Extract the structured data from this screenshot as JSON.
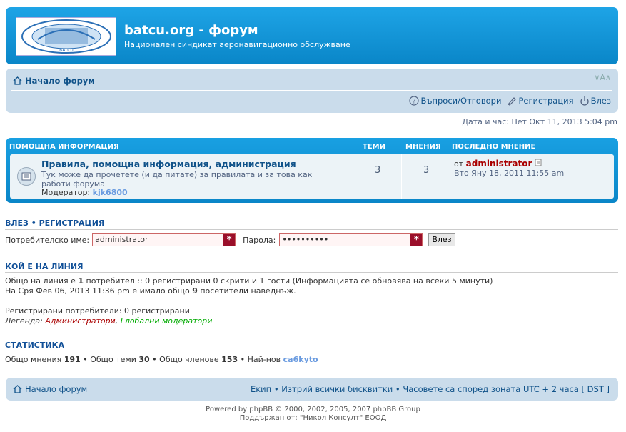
{
  "header": {
    "title": "batcu.org - форум",
    "description": "Национален синдикат аеронавигационно обслужване",
    "logo_text": "BATCU"
  },
  "navbar": {
    "home": "Начало форум",
    "font_controls": "∨A∧",
    "faq": "Въпроси/Отговори",
    "register": "Регистрация",
    "login": "Влез"
  },
  "datetime": "Дата и час: Пет Окт 11, 2013 5:04 pm",
  "forum_table": {
    "headers": {
      "section": "ПОМОЩНА ИНФОРМАЦИЯ",
      "topics": "ТЕМИ",
      "posts": "МНЕНИЯ",
      "last_post": "ПОСЛЕДНО МНЕНИЕ"
    },
    "row": {
      "title": "Правила, помощна информация, администрация",
      "description": "Тук може да прочетете (и да питате) за правилата и за това как работи форума",
      "moderator_label": "Модератор:",
      "moderator": "kjk6800",
      "topics": "3",
      "posts": "3",
      "last_by_label": "от",
      "last_by": "administrator",
      "last_date": "Вто Яну 18, 2011 11:55 am"
    }
  },
  "login": {
    "title_login": "ВЛЕЗ",
    "title_sep": "•",
    "title_register": "РЕГИСТРАЦИЯ",
    "username_label": "Потребителско име:",
    "username_value": "administrator",
    "password_label": "Парола:",
    "password_value": "••••••••••",
    "submit": "Влез"
  },
  "online": {
    "title": "КОЙ Е НА ЛИНИЯ",
    "line1_pre": "Общо на линия е",
    "line1_count": "1",
    "line1_post": "потребител :: 0 регистрирани 0 скрити и 1 гости (Информацията се обновява на всеки 5 минути)",
    "line2_pre": "На Сря Фев 06, 2013 11:36 pm е имало общо",
    "line2_count": "9",
    "line2_post": "посетители наведнъж.",
    "registered": "Регистрирани потребители: 0 регистрирани",
    "legend_label": "Легенда:",
    "legend_admins": "Администратори",
    "legend_sep": ",",
    "legend_mods": "Глобални модератори"
  },
  "stats": {
    "title": "СТАТИСТИКА",
    "posts_label": "Общо мнения",
    "posts": "191",
    "topics_label": "• Общо теми",
    "topics": "30",
    "members_label": "• Общо членове",
    "members": "153",
    "newest_label": "• Най-нов",
    "newest": "ca6kyto"
  },
  "footer_nav": {
    "home": "Начало форум",
    "team": "Екип",
    "sep1": "•",
    "delete_cookies": "Изтрий всички бисквитки",
    "sep2": "•",
    "timezone": "Часовете са според зоната UTC + 2 часа [ DST ]"
  },
  "footer": {
    "powered": "Powered by phpBB © 2000, 2002, 2005, 2007 phpBB Group",
    "supported": "Поддържан от: \"Никол Консулт\" ЕООД"
  },
  "colors": {
    "header_blue": "#0e92d5",
    "nav_bg": "#cadceb",
    "link": "#105289",
    "admin_red": "#aa0000",
    "mod_green": "#00aa00"
  }
}
